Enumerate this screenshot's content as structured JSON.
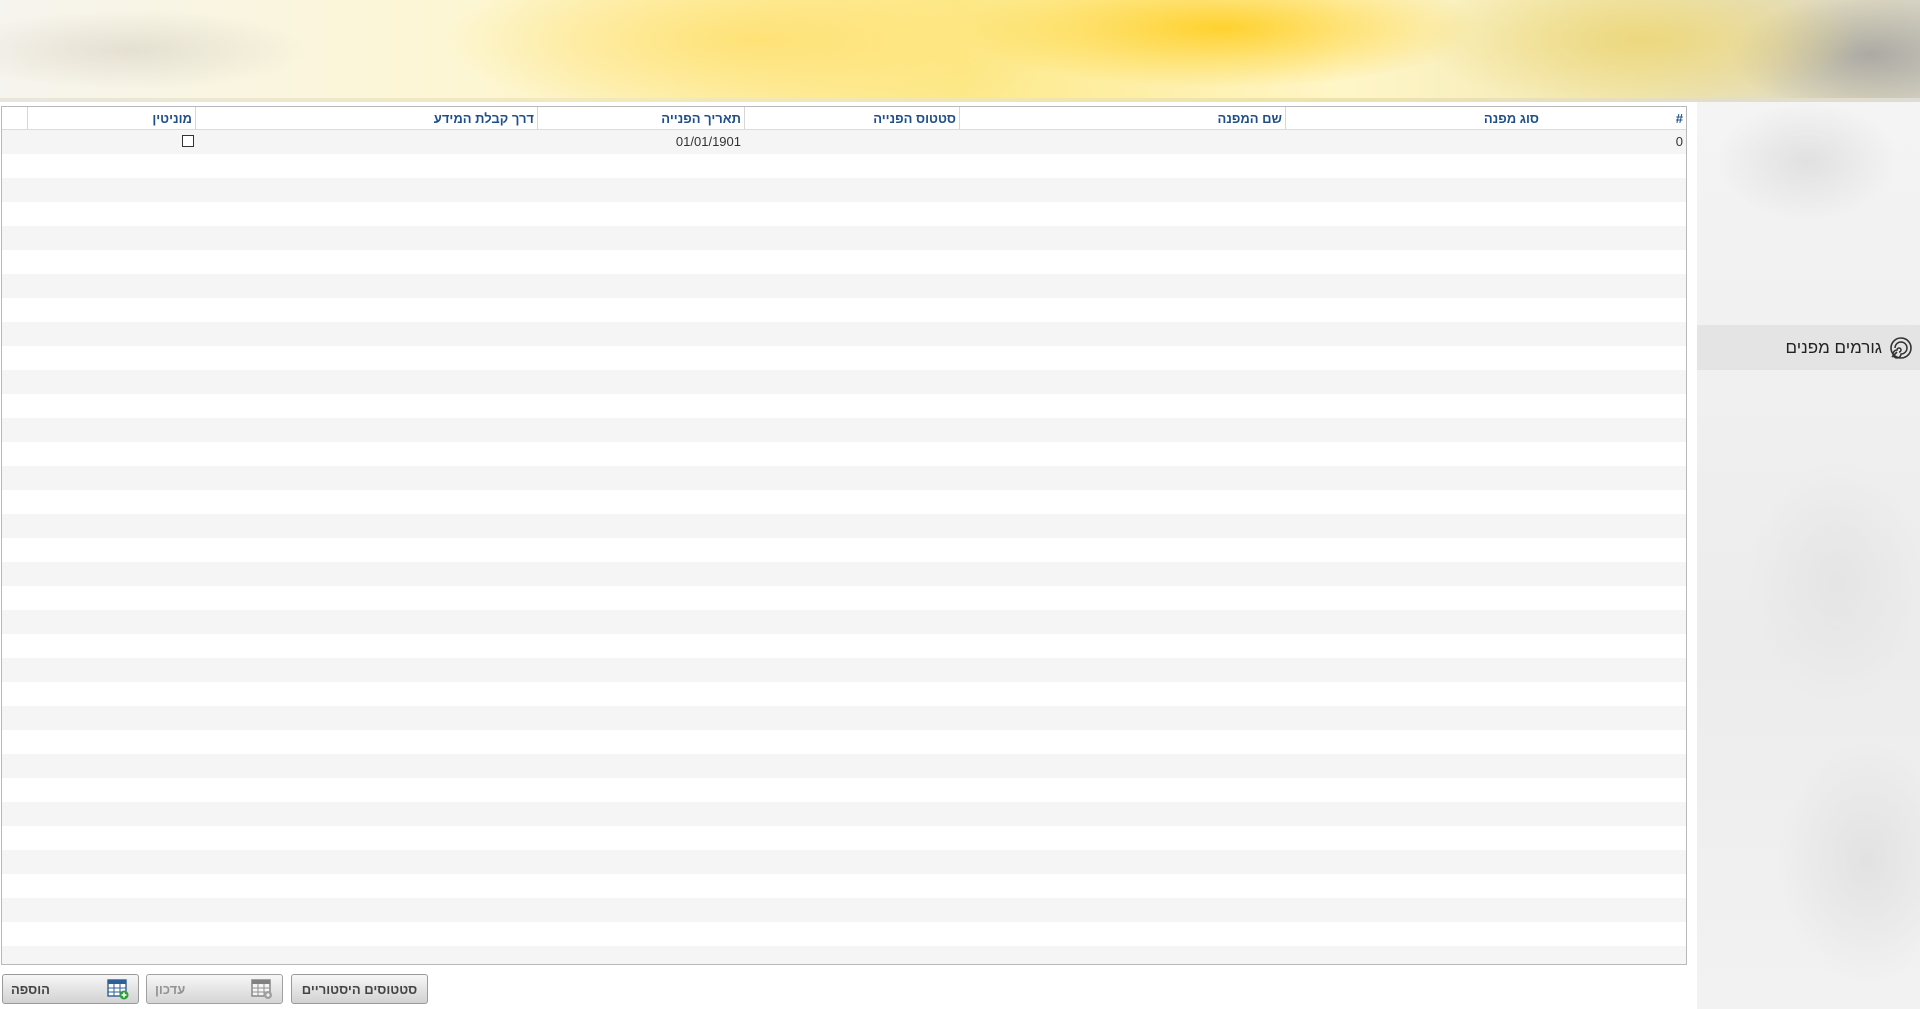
{
  "sidebar": {
    "items": [
      {
        "label": "גורמים מפנים",
        "icon": "spiral-icon"
      }
    ]
  },
  "grid": {
    "columns": [
      {
        "key": "index",
        "label": "#"
      },
      {
        "key": "referrer_type",
        "label": "סוג מפנה"
      },
      {
        "key": "referrer_name",
        "label": "שם המפנה"
      },
      {
        "key": "referral_status",
        "label": "סטטוס הפנייה"
      },
      {
        "key": "referral_date",
        "label": "תאריך הפנייה"
      },
      {
        "key": "info_channel",
        "label": "דרך קבלת המידע"
      },
      {
        "key": "monitin",
        "label": "מוניטין"
      }
    ],
    "rows": [
      {
        "index": "0",
        "referrer_type": "",
        "referrer_name": "",
        "referral_status": "",
        "referral_date": "01/01/1901",
        "info_channel": "",
        "monitin_checked": false
      }
    ],
    "empty_rows": 34
  },
  "buttons": {
    "add": {
      "label": "הוספה",
      "icon": "table-add-icon"
    },
    "update": {
      "label": "עדכון",
      "icon": "table-edit-icon",
      "disabled": true
    },
    "history": {
      "label": "סטטוסים היסטוריים"
    }
  },
  "colors": {
    "header_text": "#1f4f8a",
    "row_alt": "#f5f5f5",
    "accent_green": "#2e9e3c",
    "icon_blue": "#2d5f9a"
  }
}
